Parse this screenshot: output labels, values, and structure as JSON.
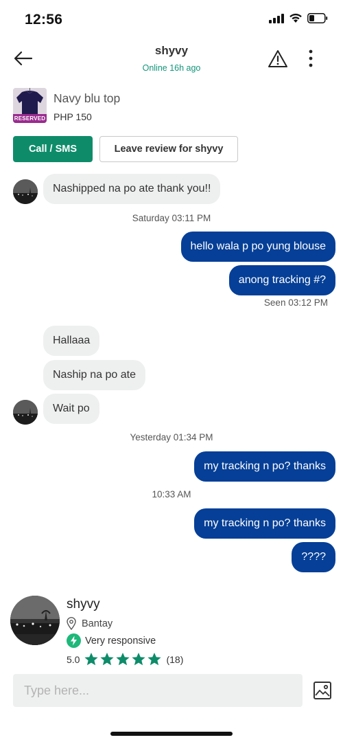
{
  "status_bar": {
    "time": "12:56"
  },
  "header": {
    "title": "shyvy",
    "subtitle": "Online 16h ago",
    "icons": {
      "back": "arrow-left-icon",
      "report": "warning-icon",
      "more": "more-vertical-icon"
    }
  },
  "listing": {
    "title": "Navy blu top",
    "price": "PHP 150",
    "badge": "RESERVED"
  },
  "actions": {
    "call_label": "Call / SMS",
    "review_label": "Leave review for shyvy"
  },
  "messages": [
    {
      "side": "in",
      "text": "Nashipped na po ate thank you!!"
    },
    {
      "type": "stamp",
      "text": "Saturday 03:11 PM"
    },
    {
      "side": "out",
      "text": "hello wala p po yung blouse"
    },
    {
      "side": "out",
      "text": "anong tracking #?"
    },
    {
      "type": "seen",
      "text": "Seen 03:12 PM"
    },
    {
      "side": "in",
      "text": "Hallaaa"
    },
    {
      "side": "in",
      "text": "Naship na po ate"
    },
    {
      "side": "in",
      "text": "Wait po"
    },
    {
      "type": "stamp",
      "text": "Yesterday 01:34 PM"
    },
    {
      "side": "out",
      "text": "my tracking n po? thanks"
    },
    {
      "type": "stamp",
      "text": "10:33 AM"
    },
    {
      "side": "out",
      "text": "my tracking n po? thanks"
    },
    {
      "side": "out",
      "text": "????"
    }
  ],
  "seller": {
    "name": "shyvy",
    "location": "Bantay",
    "responsiveness": "Very responsive",
    "rating": "5.0",
    "stars": 5,
    "review_count": "(18)"
  },
  "composer": {
    "placeholder": "Type here..."
  },
  "colors": {
    "accent_green": "#0e8c6a",
    "online_green": "#10967a",
    "outgoing_bubble": "#053f97",
    "incoming_bubble": "#eef0ef",
    "reserved_badge": "#9a2b8f"
  }
}
